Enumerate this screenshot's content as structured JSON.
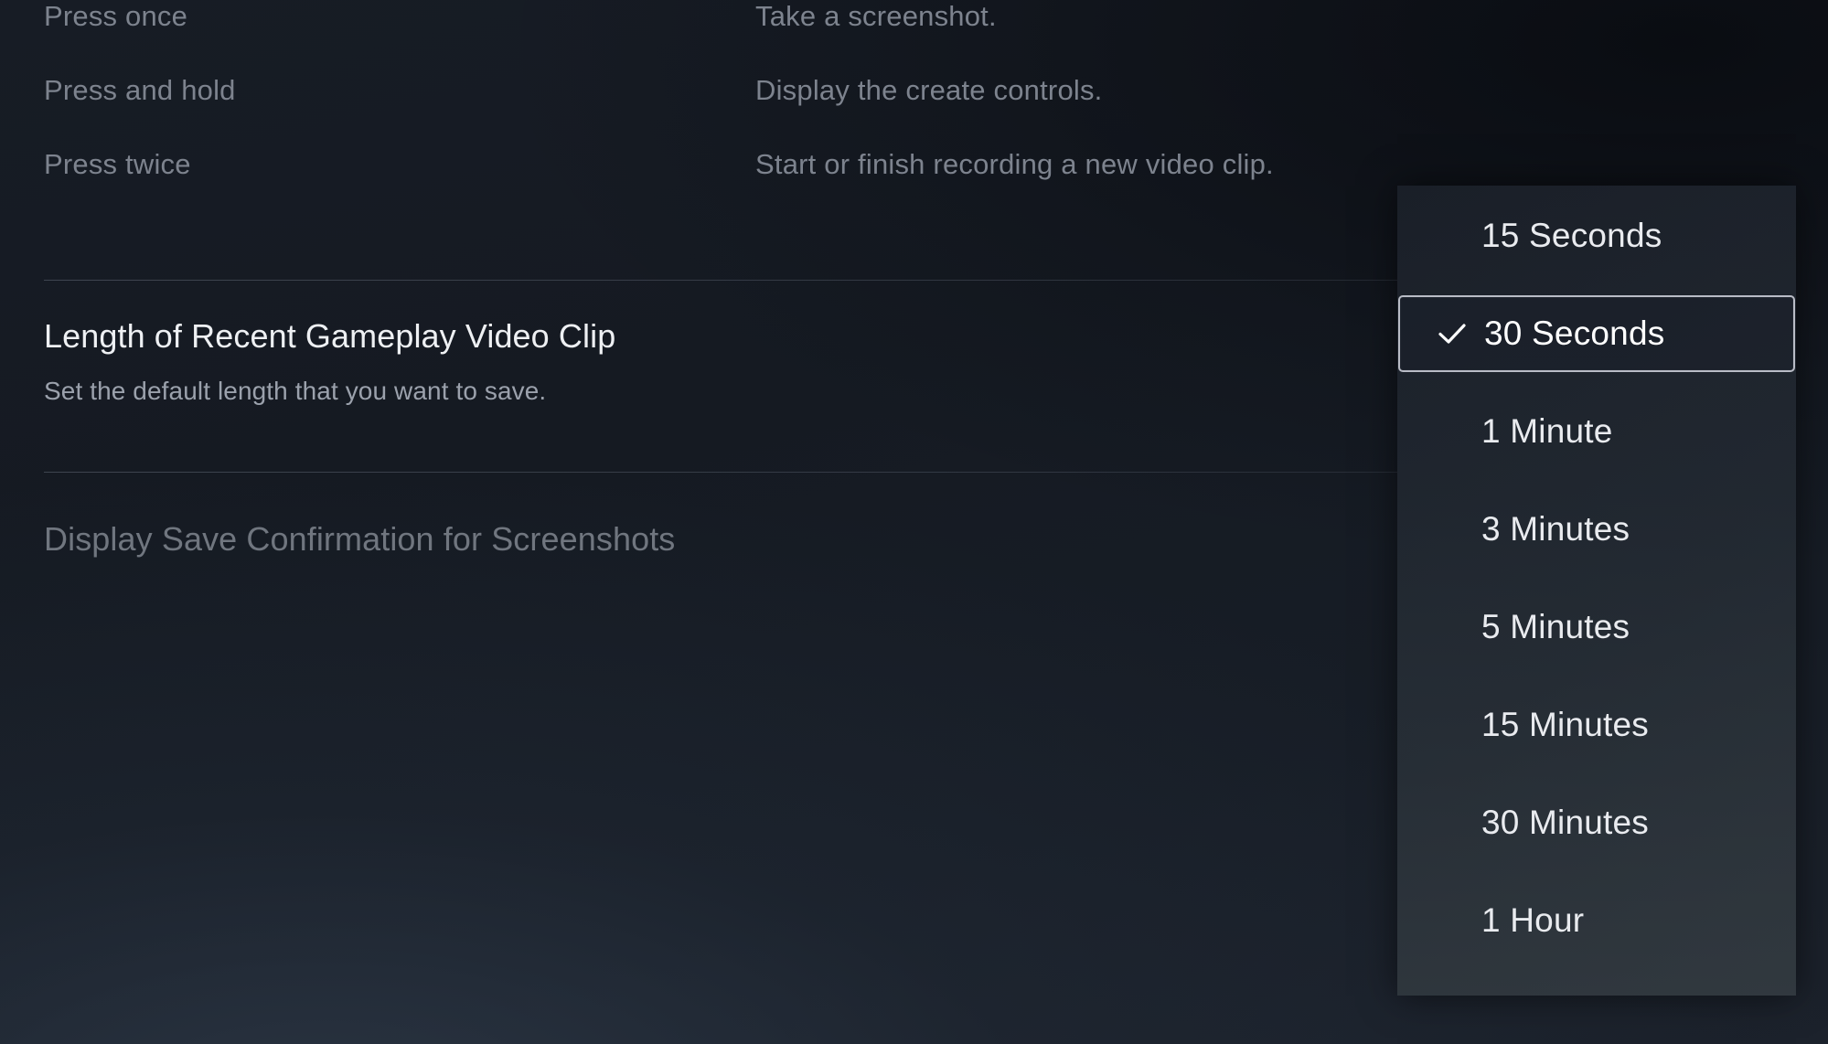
{
  "theme": {
    "background": "#161b23",
    "panel_background": "#1f252e",
    "text_primary": "#eef0f3",
    "text_secondary": "#9ba1ac",
    "text_dim": "#7d838e",
    "selection_border": "#b9bcc6",
    "divider": "#787f8e"
  },
  "button_hints": {
    "rows": [
      {
        "key": "Press once",
        "value": "Take a screenshot."
      },
      {
        "key": "Press and hold",
        "value": "Display the create controls."
      },
      {
        "key": "Press twice",
        "value": "Start or finish recording a new video clip."
      }
    ]
  },
  "settings": {
    "active": {
      "title": "Length of Recent Gameplay Video Clip",
      "description": "Set the default length that you want to save."
    },
    "next": {
      "title": "Display Save Confirmation for Screenshots"
    }
  },
  "dropdown": {
    "selected_value": "30 Seconds",
    "check_icon": "check-icon",
    "options": [
      {
        "label": "15 Seconds",
        "selected": false
      },
      {
        "label": "30 Seconds",
        "selected": true
      },
      {
        "label": "1 Minute",
        "selected": false
      },
      {
        "label": "3 Minutes",
        "selected": false
      },
      {
        "label": "5 Minutes",
        "selected": false
      },
      {
        "label": "15 Minutes",
        "selected": false
      },
      {
        "label": "30 Minutes",
        "selected": false
      },
      {
        "label": "1 Hour",
        "selected": false
      }
    ]
  }
}
